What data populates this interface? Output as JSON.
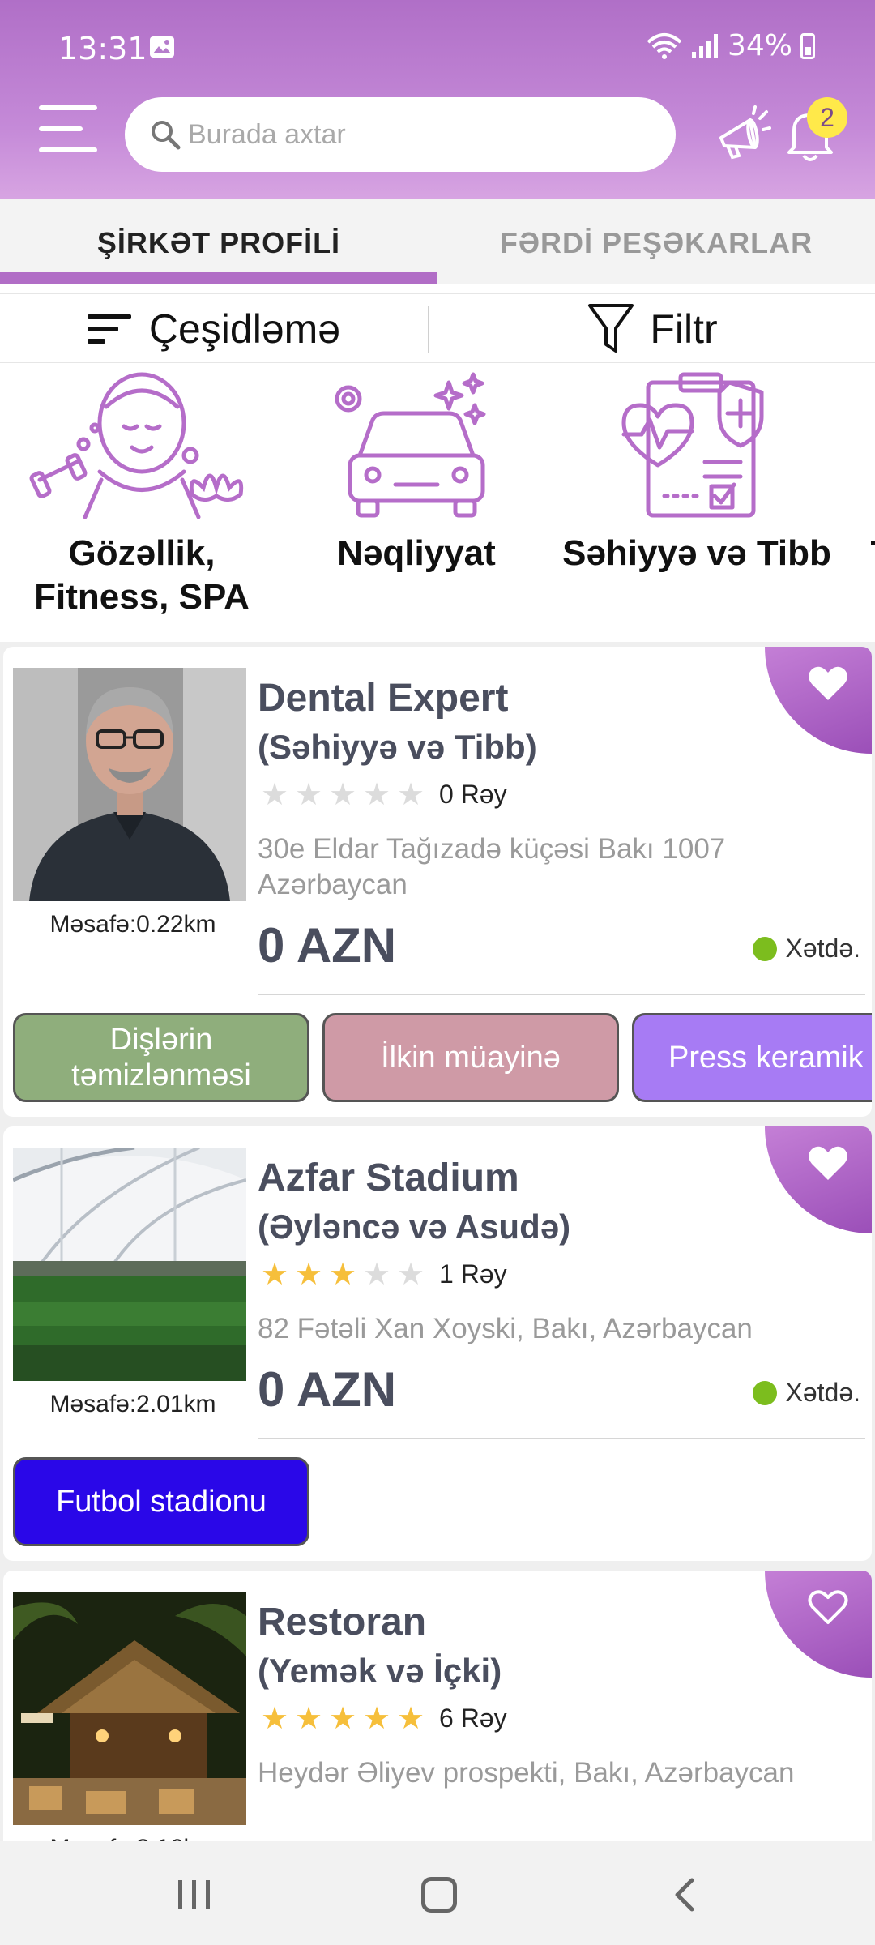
{
  "status_bar": {
    "time": "13:31",
    "battery": "34%"
  },
  "header": {
    "search_placeholder": "Burada axtar",
    "notification_count": "2",
    "colors": {
      "primary": "#b06fc7",
      "badge": "#ffe94a"
    }
  },
  "tabs": [
    {
      "label": "ŞİRKƏT PROFİLİ",
      "active": true
    },
    {
      "label": "FƏRDİ PEŞƏKARLAR",
      "active": false
    }
  ],
  "toolbar": {
    "sort_label": "Çeşidləmə",
    "filter_label": "Filtr"
  },
  "categories": [
    {
      "label_line1": "Gözəllik,",
      "label_line2": "Fitness, SPA",
      "icon": "beauty-fitness-spa-icon"
    },
    {
      "label_line1": "Nəqliyyat",
      "icon": "car-icon"
    },
    {
      "label_line1": "Səhiyyə və Tibb",
      "icon": "health-clipboard-icon"
    },
    {
      "label_line1": "T",
      "icon": ""
    }
  ],
  "listings": [
    {
      "title": "Dental Expert",
      "category": "(Səhiyyə və Tibb)",
      "rating": 0,
      "reviews": "0 Rəy",
      "address": "30e Eldar Tağızadə küçəsi Bakı 1007 Azərbaycan",
      "price": "0 AZN",
      "distance": "Məsafə:0.22km",
      "status": "Xətdə.",
      "favorite": true,
      "services": [
        {
          "label_line1": "Dişlərin",
          "label_line2": "təmizlənməsi",
          "color": "#8fae7c"
        },
        {
          "label_line1": "İlkin müayinə",
          "color": "#cf9aa6"
        },
        {
          "label_line1": "Press keramik",
          "color": "#a77bf4"
        }
      ]
    },
    {
      "title": "Azfar Stadium",
      "category": "(Əyləncə və Asudə)",
      "rating": 3,
      "reviews": "1 Rəy",
      "address": "82 Fətəli Xan Xoyski, Bakı, Azərbaycan",
      "price": "0 AZN",
      "distance": "Məsafə:2.01km",
      "status": "Xətdə.",
      "favorite": true,
      "services": [
        {
          "label_line1": "Futbol stadionu",
          "color": "#2a07e8"
        }
      ]
    },
    {
      "title": "Restoran",
      "category": "(Yemək və İçki)",
      "rating": 5,
      "reviews": "6 Rəy",
      "address": "Heydər Əliyev prospekti, Bakı, Azərbaycan",
      "favorite": false
    }
  ]
}
